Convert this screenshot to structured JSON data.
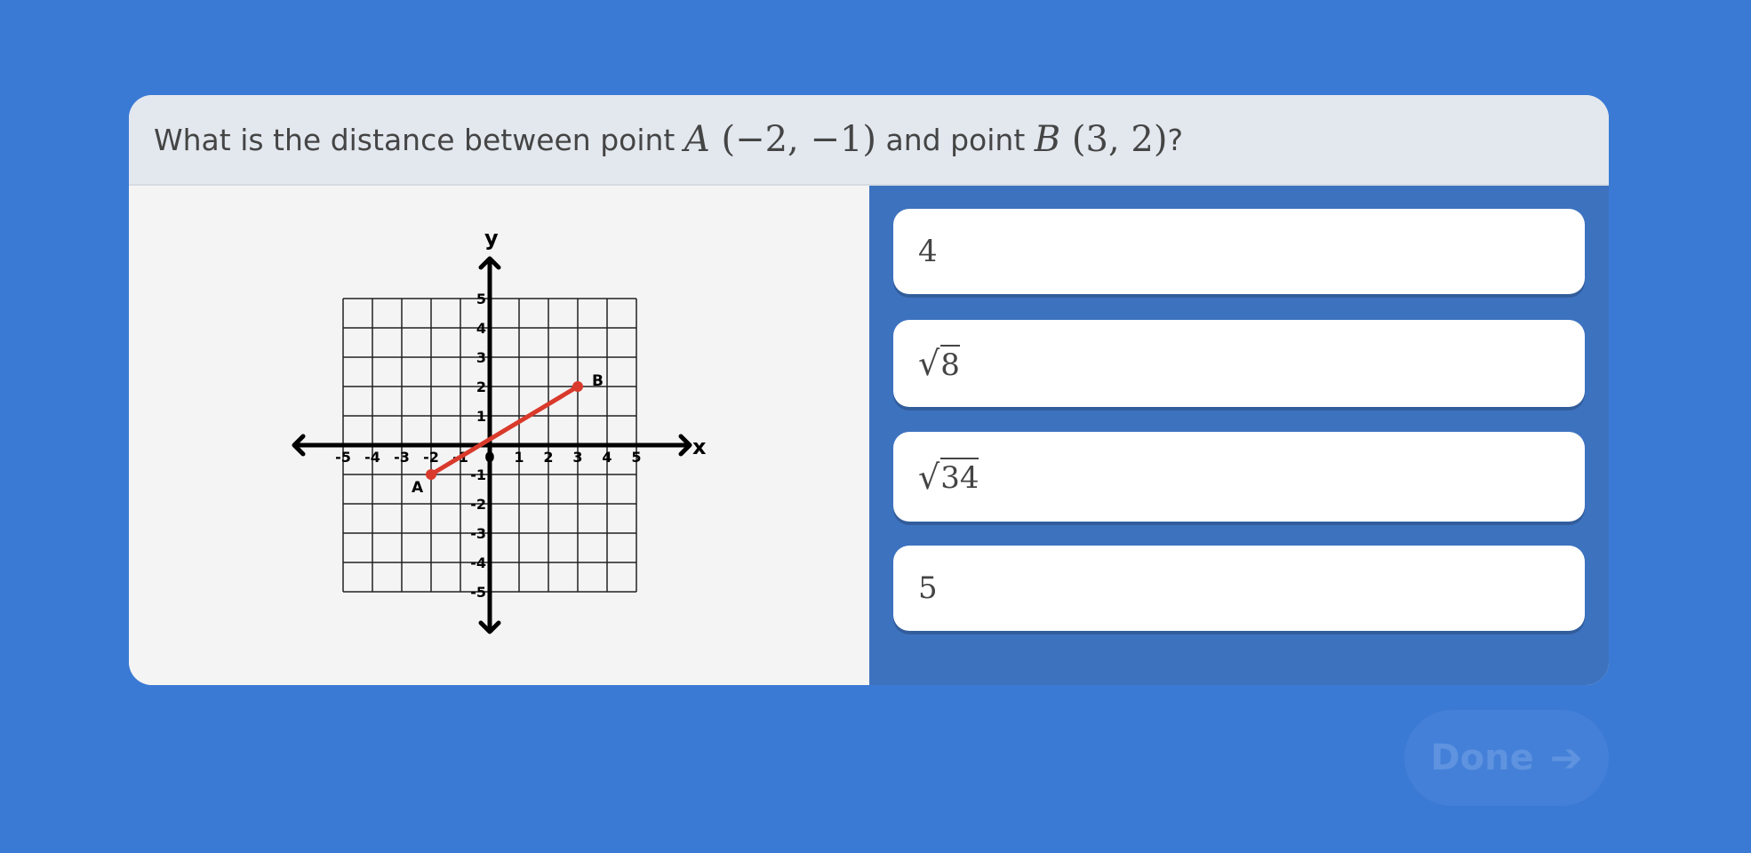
{
  "question": {
    "prefix": "What is the distance between point ",
    "point_a_label": "A",
    "point_a_coords": "(−2, −1)",
    "middle": " and point ",
    "point_b_label": "B",
    "point_b_coords": "(3, 2)",
    "suffix": "?"
  },
  "graph": {
    "x_axis_label": "x",
    "y_axis_label": "y",
    "x_ticks": [
      "-5",
      "-4",
      "-3",
      "-2",
      "-1",
      "0",
      "1",
      "2",
      "3",
      "4",
      "5"
    ],
    "y_ticks": [
      "5",
      "4",
      "3",
      "2",
      "1",
      "-1",
      "-2",
      "-3",
      "-4",
      "-5"
    ],
    "points": [
      {
        "label": "A",
        "x": -2,
        "y": -1
      },
      {
        "label": "B",
        "x": 3,
        "y": 2
      }
    ],
    "segment_color": "#d93a2b"
  },
  "options": [
    {
      "id": "opt1",
      "radical": false,
      "text": "4"
    },
    {
      "id": "opt2",
      "radical": true,
      "text": "8"
    },
    {
      "id": "opt3",
      "radical": true,
      "text": "34"
    },
    {
      "id": "opt4",
      "radical": false,
      "text": "5"
    }
  ],
  "done_button": {
    "label": "Done",
    "icon": "arrow-right-icon"
  },
  "colors": {
    "background": "#3b7ad4",
    "answers_panel": "#3d72bf",
    "question_bar": "#e3e8ef"
  }
}
